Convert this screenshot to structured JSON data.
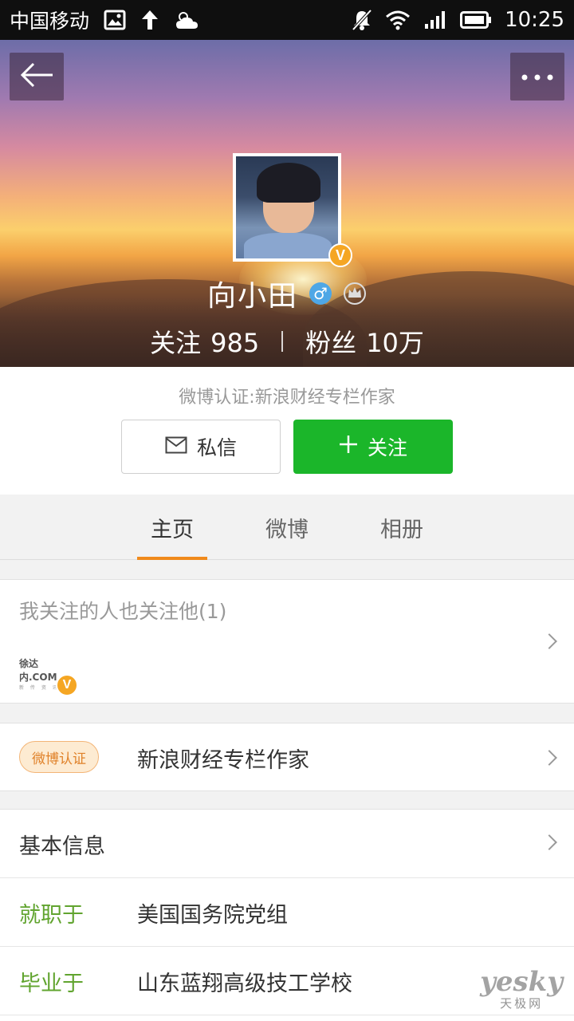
{
  "status_bar": {
    "carrier": "中国移动",
    "time": "10:25",
    "icons": [
      "image-icon",
      "upload-icon",
      "weather-icon",
      "mute-icon",
      "wifi-icon",
      "signal-icon",
      "battery-icon"
    ]
  },
  "profile": {
    "name": "向小田",
    "gender_symbol": "♂",
    "verified_badge": "V",
    "follow_label": "关注",
    "follow_count": "985",
    "fans_label": "粉丝",
    "fans_count": "10万",
    "verification_line": "微博认证:新浪财经专栏作家"
  },
  "actions": {
    "message_label": "私信",
    "follow_label": "关注",
    "follow_color": "#1bb62a"
  },
  "tabs": [
    {
      "label": "主页",
      "active": true
    },
    {
      "label": "微博",
      "active": false
    },
    {
      "label": "相册",
      "active": false
    }
  ],
  "tab_accent": "#f08a1c",
  "mutual": {
    "title": "我关注的人也关注他(1)",
    "logo_text": "徐达内.COM",
    "logo_sub": "新 传 资 讯",
    "badge": "V"
  },
  "verify_card": {
    "tag": "微博认证",
    "text": "新浪财经专栏作家"
  },
  "basic_info": {
    "title": "基本信息",
    "rows": [
      {
        "label": "就职于",
        "value": "美国国务院党组"
      },
      {
        "label": "毕业于",
        "value": "山东蓝翔高级技工学校"
      }
    ]
  },
  "watermark": {
    "main": "yesky",
    "sub": "天极网"
  }
}
